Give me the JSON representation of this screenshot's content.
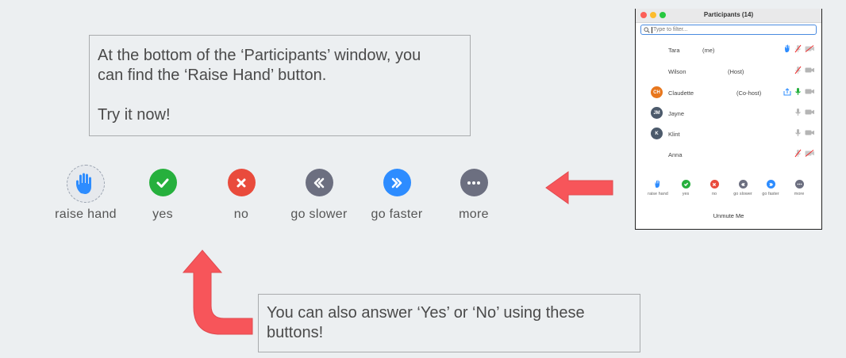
{
  "callout_top": {
    "line1": "At the bottom of the ‘Participants’ window, you",
    "line2": "can find the ‘Raise Hand’ button.",
    "line3": "Try it now!"
  },
  "callout_bottom": {
    "line1": "You can also answer ‘Yes’ or ‘No’ using these",
    "line2": "buttons!"
  },
  "reactions": [
    {
      "label": "raise hand",
      "icon": "raise-hand-icon",
      "color": "#2d8cff"
    },
    {
      "label": "yes",
      "icon": "check-icon",
      "color": "#26b03d"
    },
    {
      "label": "no",
      "icon": "x-icon",
      "color": "#e94b3c"
    },
    {
      "label": "go slower",
      "icon": "rewind-icon",
      "color": "#6c6f80"
    },
    {
      "label": "go faster",
      "icon": "fast-forward-icon",
      "color": "#2d8cff"
    },
    {
      "label": "more",
      "icon": "ellipsis-icon",
      "color": "#6c6f80"
    }
  ],
  "window": {
    "title": "Participants (14)",
    "search_placeholder": "Type to filter...",
    "participants": [
      {
        "name": "Tara",
        "tag": "(me)",
        "avatar": "",
        "avatar_color": ""
      },
      {
        "name": "Wilson",
        "tag": "(Host)",
        "avatar": "",
        "avatar_color": ""
      },
      {
        "name": "Claudette",
        "tag": "(Co-host)",
        "avatar": "CH",
        "avatar_color": "#e8771d"
      },
      {
        "name": "Jayne",
        "tag": "",
        "avatar": "JM",
        "avatar_color": "#4c5a6b"
      },
      {
        "name": "Klint",
        "tag": "",
        "avatar": "K",
        "avatar_color": "#4c5a6b"
      },
      {
        "name": "Anna",
        "tag": "",
        "avatar": "",
        "avatar_color": ""
      }
    ],
    "mini_reactions": [
      "raise hand",
      "yes",
      "no",
      "go slower",
      "go faster",
      "more"
    ],
    "unmute_label": "Unmute Me"
  },
  "colors": {
    "background": "#eceff1",
    "arrow": "#f7555a",
    "zoom_blue": "#2d8cff",
    "green": "#26b03d",
    "red": "#e94b3c",
    "gray": "#6c6f80"
  }
}
